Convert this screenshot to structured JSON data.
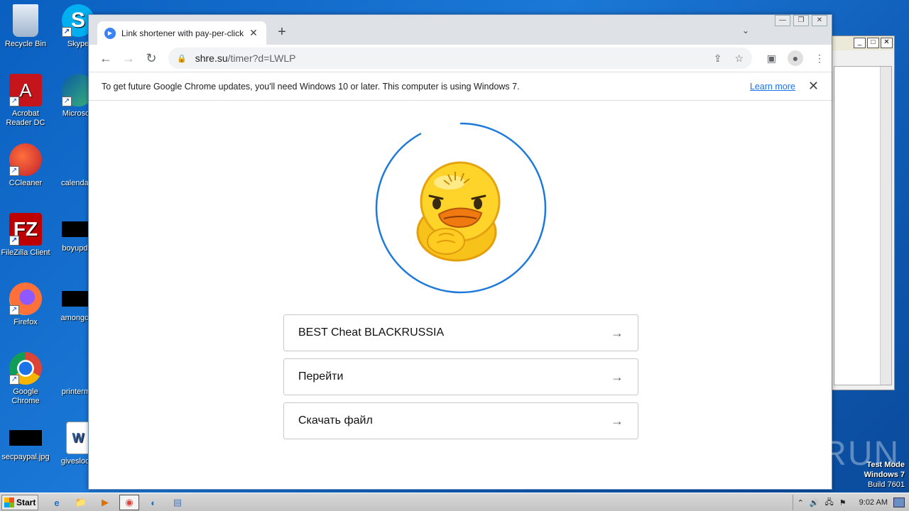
{
  "desktop": {
    "icons": [
      {
        "label": "Recycle Bin",
        "icon": "recycle-bin-icon"
      },
      {
        "label": "Skype",
        "icon": "skype-icon"
      },
      {
        "label": "Acrobat Reader DC",
        "icon": "acrobat-icon"
      },
      {
        "label": "Microsoft",
        "icon": "edge-icon"
      },
      {
        "label": "CCleaner",
        "icon": "ccleaner-icon"
      },
      {
        "label": "calendarc",
        "icon": "file-icon"
      },
      {
        "label": "FileZilla Client",
        "icon": "filezilla-icon"
      },
      {
        "label": "boyupdat",
        "icon": "black-file-icon"
      },
      {
        "label": "Firefox",
        "icon": "firefox-icon"
      },
      {
        "label": "amongcor",
        "icon": "black-file-icon"
      },
      {
        "label": "Google Chrome",
        "icon": "chrome-icon"
      },
      {
        "label": "printermo",
        "icon": "file-icon"
      },
      {
        "label": "secpaypal.jpg",
        "icon": "image-icon"
      },
      {
        "label": "giveslocal",
        "icon": "word-icon"
      }
    ]
  },
  "browser": {
    "tab_title": "Link shortener with pay-per-click",
    "tab_close": "✕",
    "new_tab": "+",
    "url_host": "shre.su",
    "url_path": "/timer?d=LWLP",
    "infobar": {
      "message": "To get future Google Chrome updates, you'll need Windows 10 or later. This computer is using Windows 7.",
      "link": "Learn more",
      "close": "✕"
    }
  },
  "page": {
    "loader_progress": 0.92,
    "buttons": [
      {
        "label": "BEST Cheat BLACKRUSSIA",
        "arrow": "→"
      },
      {
        "label": "Перейти",
        "arrow": "→"
      },
      {
        "label": "Скачать файл",
        "arrow": "→"
      }
    ]
  },
  "watermark": "ANY RUN",
  "test_mode": {
    "line1": "Test Mode",
    "line2": "Windows 7",
    "line3": "Build 7601"
  },
  "taskbar": {
    "start_label": "Start",
    "clock": "9:02 AM"
  },
  "colors": {
    "accent": "#1a73e8",
    "loader": "#1e7ad9"
  }
}
